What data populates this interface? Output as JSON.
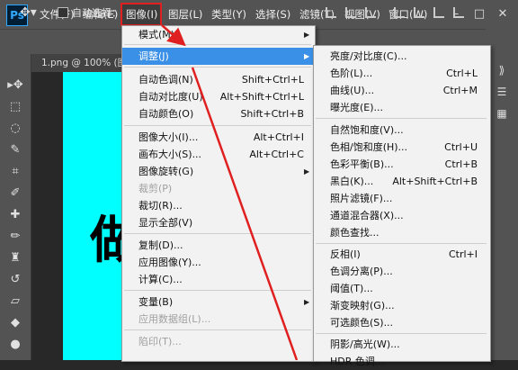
{
  "app": {
    "logo": "Ps"
  },
  "menubar": {
    "items": [
      "文件(F)",
      "编辑(E)",
      "图像(I)",
      "图层(L)",
      "类型(Y)",
      "选择(S)",
      "滤镜(T)",
      "视图(V)",
      "窗口(W)"
    ],
    "window_controls": [
      "–",
      "□",
      "✕"
    ]
  },
  "options_bar": {
    "auto_select_label": "自动选择："
  },
  "document": {
    "tab_title": "1.png @ 100% (图层",
    "canvas_text": "做"
  },
  "image_menu": {
    "items": [
      {
        "label": "模式(M)",
        "shortcut": "",
        "submenu": true,
        "disabled": false
      },
      {
        "label": "调整(J)",
        "shortcut": "",
        "submenu": true,
        "disabled": false,
        "highlighted": true
      },
      {
        "label": "自动色调(N)",
        "shortcut": "Shift+Ctrl+L",
        "submenu": false,
        "disabled": false
      },
      {
        "label": "自动对比度(U)",
        "shortcut": "Alt+Shift+Ctrl+L",
        "submenu": false,
        "disabled": false
      },
      {
        "label": "自动颜色(O)",
        "shortcut": "Shift+Ctrl+B",
        "submenu": false,
        "disabled": false
      },
      {
        "label": "图像大小(I)...",
        "shortcut": "Alt+Ctrl+I",
        "submenu": false,
        "disabled": false
      },
      {
        "label": "画布大小(S)...",
        "shortcut": "Alt+Ctrl+C",
        "submenu": false,
        "disabled": false
      },
      {
        "label": "图像旋转(G)",
        "shortcut": "",
        "submenu": true,
        "disabled": false
      },
      {
        "label": "裁剪(P)",
        "shortcut": "",
        "submenu": false,
        "disabled": true
      },
      {
        "label": "裁切(R)...",
        "shortcut": "",
        "submenu": false,
        "disabled": false
      },
      {
        "label": "显示全部(V)",
        "shortcut": "",
        "submenu": false,
        "disabled": false
      },
      {
        "label": "复制(D)...",
        "shortcut": "",
        "submenu": false,
        "disabled": false
      },
      {
        "label": "应用图像(Y)...",
        "shortcut": "",
        "submenu": false,
        "disabled": false
      },
      {
        "label": "计算(C)...",
        "shortcut": "",
        "submenu": false,
        "disabled": false
      },
      {
        "label": "变量(B)",
        "shortcut": "",
        "submenu": true,
        "disabled": false
      },
      {
        "label": "应用数据组(L)...",
        "shortcut": "",
        "submenu": false,
        "disabled": true
      },
      {
        "label": "陷印(T)...",
        "shortcut": "",
        "submenu": false,
        "disabled": true
      }
    ]
  },
  "adjust_menu": {
    "items": [
      {
        "label": "亮度/对比度(C)...",
        "shortcut": ""
      },
      {
        "label": "色阶(L)...",
        "shortcut": "Ctrl+L"
      },
      {
        "label": "曲线(U)...",
        "shortcut": "Ctrl+M"
      },
      {
        "label": "曝光度(E)...",
        "shortcut": ""
      },
      {
        "label": "自然饱和度(V)...",
        "shortcut": ""
      },
      {
        "label": "色相/饱和度(H)...",
        "shortcut": "Ctrl+U"
      },
      {
        "label": "色彩平衡(B)...",
        "shortcut": "Ctrl+B"
      },
      {
        "label": "黑白(K)...",
        "shortcut": "Alt+Shift+Ctrl+B"
      },
      {
        "label": "照片滤镜(F)...",
        "shortcut": ""
      },
      {
        "label": "通道混合器(X)...",
        "shortcut": ""
      },
      {
        "label": "颜色查找...",
        "shortcut": ""
      },
      {
        "label": "反相(I)",
        "shortcut": "Ctrl+I"
      },
      {
        "label": "色调分离(P)...",
        "shortcut": ""
      },
      {
        "label": "阈值(T)...",
        "shortcut": ""
      },
      {
        "label": "渐变映射(G)...",
        "shortcut": ""
      },
      {
        "label": "可选颜色(S)...",
        "shortcut": ""
      },
      {
        "label": "阴影/高光(W)...",
        "shortcut": ""
      },
      {
        "label": "HDR 色调...",
        "shortcut": ""
      }
    ]
  },
  "colors": {
    "highlight": "#3a8fe6",
    "annotation": "#e02020",
    "canvas": "#00ffff"
  }
}
